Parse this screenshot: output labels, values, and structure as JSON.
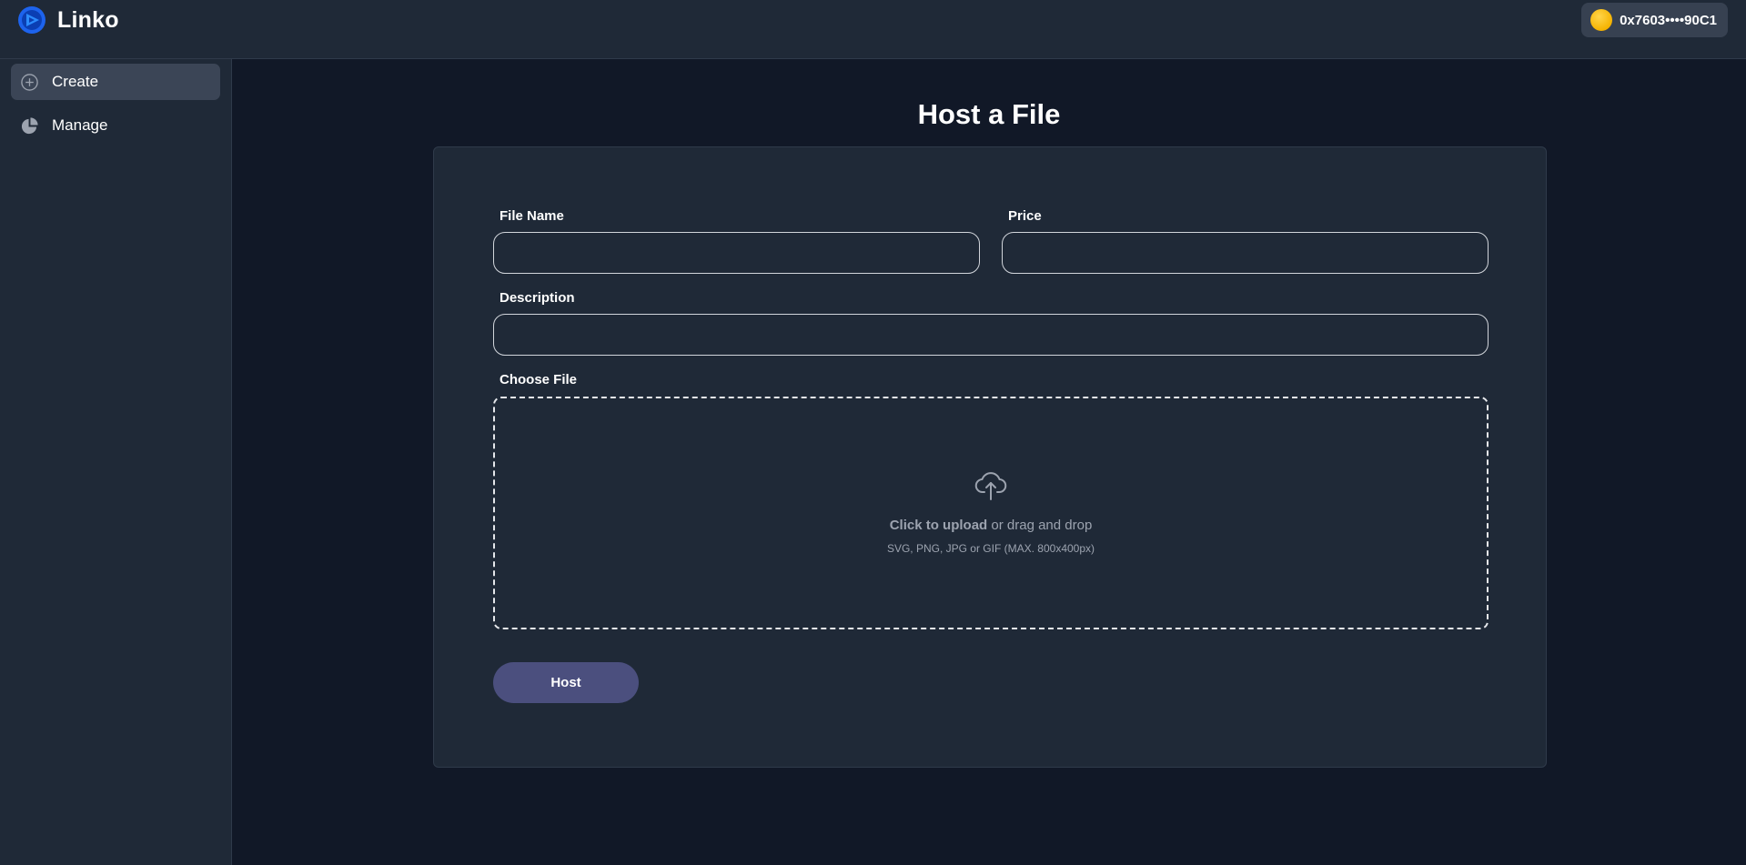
{
  "app": {
    "name": "Linko"
  },
  "wallet": {
    "address": "0x7603••••90C1",
    "icon": "coin-icon",
    "color": "#f5b301"
  },
  "sidebar": {
    "items": [
      {
        "label": "Create",
        "icon": "plus-circle-icon",
        "active": true
      },
      {
        "label": "Manage",
        "icon": "pie-chart-icon",
        "active": false
      }
    ]
  },
  "main": {
    "title": "Host a File",
    "form": {
      "file_name": {
        "label": "File Name",
        "value": "",
        "placeholder": ""
      },
      "price": {
        "label": "Price",
        "value": "",
        "placeholder": ""
      },
      "description": {
        "label": "Description",
        "value": "",
        "placeholder": ""
      },
      "choose_file": {
        "label": "Choose File",
        "icon": "cloud-upload-icon",
        "click_text": "Click to upload",
        "drag_text": " or drag and drop",
        "hint": "SVG, PNG, JPG or GIF (MAX. 800x400px)"
      },
      "submit_label": "Host"
    }
  },
  "colors": {
    "background": "#111827",
    "panel": "#1f2937",
    "active_nav": "#3b4556",
    "accent": "#4b4f7e",
    "brand_blue": "#1d63ed"
  }
}
